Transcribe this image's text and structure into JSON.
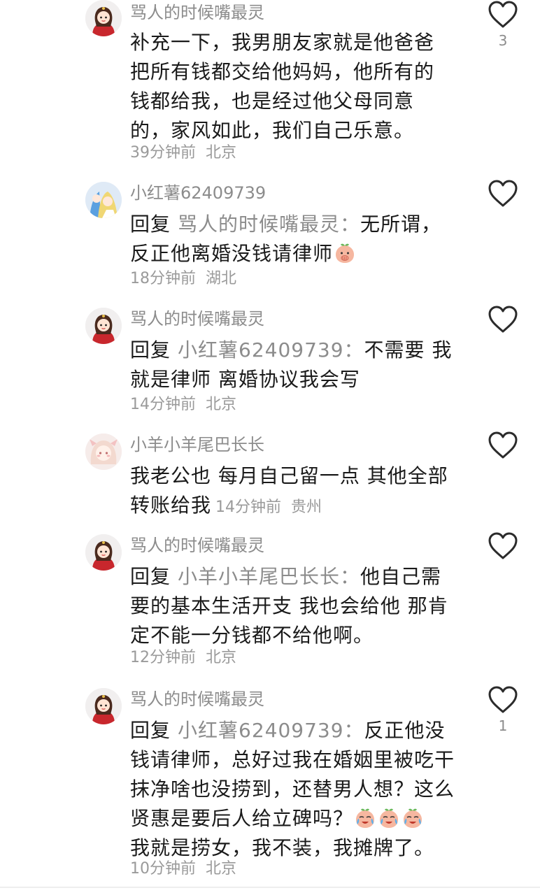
{
  "comments": [
    {
      "username": "骂人的时候嘴最灵",
      "text": "补充一下，我男朋友家就是他爸爸把所有钱都交给他妈妈，他所有的钱都给我，也是经过他父母同意的，家风如此，我们自己乐意。",
      "time": "39分钟前",
      "location": "北京",
      "likes": "3"
    },
    {
      "username": "小红薯62409739",
      "reply_prefix": "回复",
      "reply_to": "骂人的时候嘴最灵：",
      "text_line1": "无所谓，",
      "text_line2": "反正他离婚没钱请律师",
      "emoji": "covering-mouth-peach",
      "time": "18分钟前",
      "location": "湖北"
    },
    {
      "username": "骂人的时候嘴最灵",
      "reply_prefix": "回复",
      "reply_to": "小红薯62409739：",
      "text_line1": "不需要 我",
      "text_line2": "就是律师 离婚协议我会写",
      "time": "14分钟前",
      "location": "北京"
    },
    {
      "username": "小羊小羊尾巴长长",
      "text_line1": "我老公也 每月自己留一点 其他全部",
      "text_line2": "转账给我",
      "time": "14分钟前",
      "location": "贵州"
    },
    {
      "username": "骂人的时候嘴最灵",
      "reply_prefix": "回复",
      "reply_to": "小羊小羊尾巴长长：",
      "text_line1": "他自己需",
      "text_rest": "要的基本生活开支 我也会给他 那肯定不能一分钱都不给他啊。",
      "time": "12分钟前",
      "location": "北京"
    },
    {
      "username": "骂人的时候嘴最灵",
      "reply_prefix": "回复",
      "reply_to": "小红薯62409739：",
      "text_line1": "反正他没钱",
      "text_rest": "请律师，总好过我在婚姻里被吃干抹净啥也没捞到，还替男人想？这么贤惠是要后人给立碑吗？",
      "emoji": "crying-laughing-peach",
      "text_last": "我就是捞女，我不装，我摊牌了。",
      "time": "10分钟前",
      "location": "北京",
      "likes": "1"
    }
  ]
}
